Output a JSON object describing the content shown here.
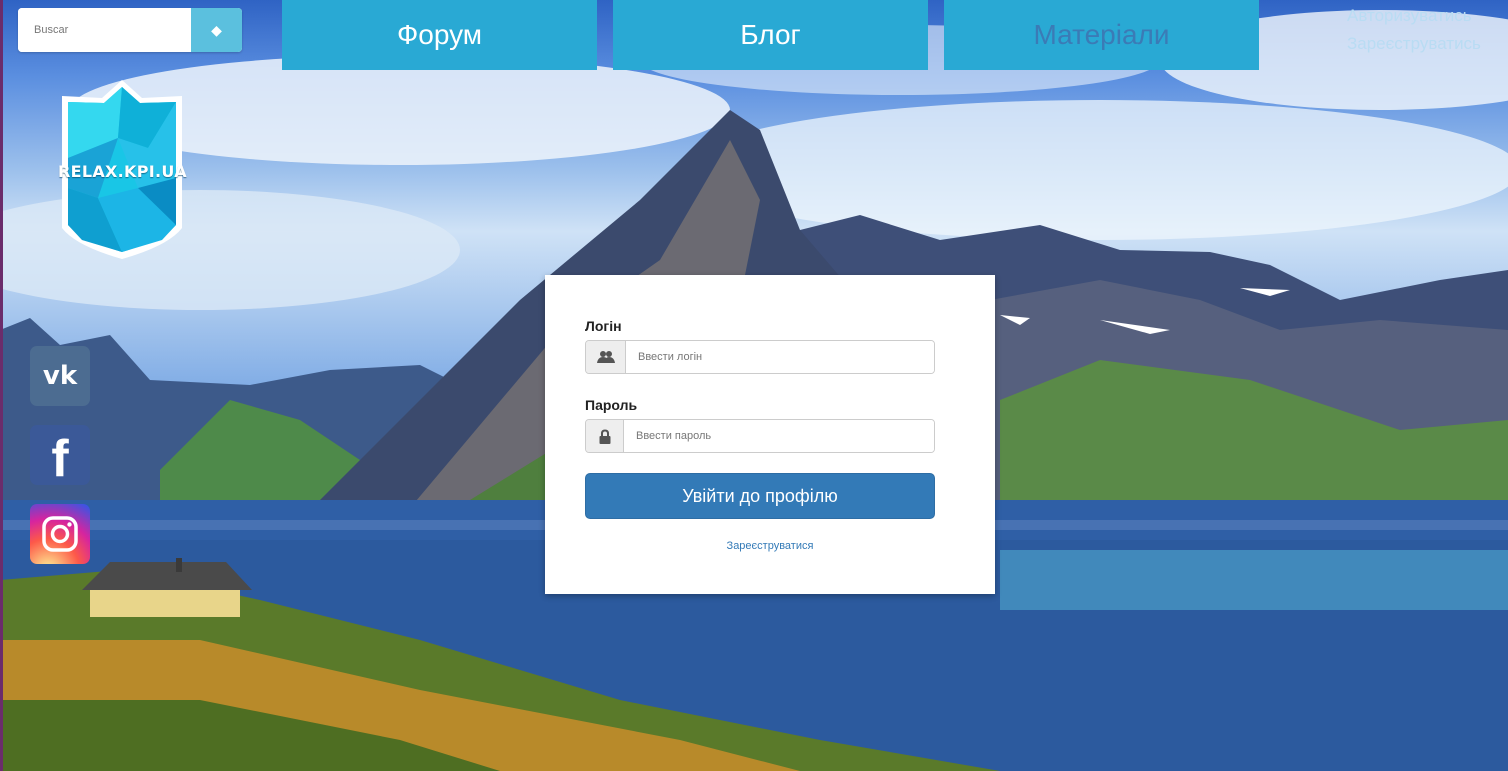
{
  "search": {
    "placeholder": "Buscar",
    "button_icon": "diamond-icon"
  },
  "nav": {
    "forum": "Форум",
    "blog": "Блог",
    "materials": "Матеріали"
  },
  "auth": {
    "login": "Авторизуватись",
    "register": "Зареєструватись"
  },
  "logo": {
    "text": "RELAX.KPI.UA"
  },
  "social": [
    {
      "name": "vk",
      "glyph": "vk"
    },
    {
      "name": "facebook",
      "glyph": "f"
    },
    {
      "name": "instagram",
      "icon": "instagram-icon"
    }
  ],
  "login_form": {
    "login_label": "Логін",
    "login_placeholder": "Ввести логін",
    "password_label": "Пароль",
    "password_placeholder": "Ввести пароль",
    "submit_label": "Увійти до профілю",
    "register_link": "Зареєструватися"
  },
  "colors": {
    "nav": "#29a9d4",
    "primary": "#337ab7",
    "search_button": "#5bc0de"
  }
}
